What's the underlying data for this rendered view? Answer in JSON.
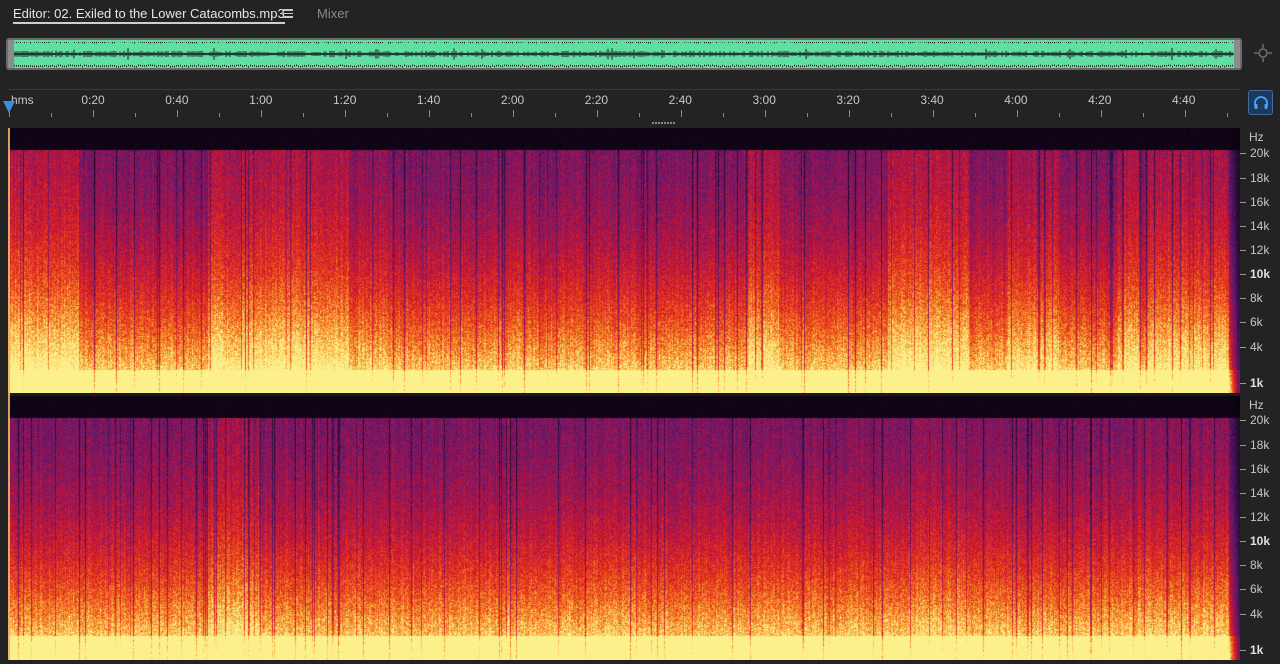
{
  "tabs": {
    "editor_label": "Editor: 02. Exiled to the Lower Catacombs.mp3",
    "mixer_label": "Mixer",
    "menu_icon": "hamburger-menu-icon"
  },
  "overview": {
    "waveform_color": "#5fe0a2",
    "zoom_icon": "zoom-navigator-icon"
  },
  "ruler": {
    "unit": "hms",
    "labels": [
      "0:20",
      "0:40",
      "1:00",
      "1:20",
      "1:40",
      "2:00",
      "2:20",
      "2:40",
      "3:00",
      "3:20",
      "3:40",
      "4:00",
      "4:20",
      "4:40"
    ],
    "playhead_color": "#3d8ee0",
    "headphone_icon": "headphone-monitor-icon"
  },
  "channels": [
    {
      "hz_title": "Hz",
      "hz_labels": [
        "20k",
        "18k",
        "16k",
        "14k",
        "12k",
        "10k",
        "8k",
        "6k",
        "4k",
        "1k"
      ]
    },
    {
      "hz_title": "Hz",
      "hz_labels": [
        "20k",
        "18k",
        "16k",
        "14k",
        "12k",
        "10k",
        "8k",
        "6k",
        "4k",
        "1k"
      ]
    }
  ],
  "colors": {
    "accent": "#3d8ee0",
    "spectral_low": "#f7e27a",
    "spectral_mid": "#e0282e",
    "spectral_high": "#4a1a6e"
  }
}
